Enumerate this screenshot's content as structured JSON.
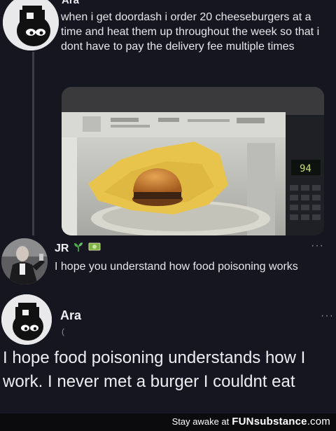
{
  "tweet1": {
    "author_name": "Ara",
    "text": "when i get doordash i order 20 cheeseburgers at a time and heat them up throughout the week so that i dont have to pay the delivery fee multiple times",
    "media": {
      "microwave_display": "94"
    }
  },
  "reply": {
    "author_name": "JR",
    "badges": [
      "seedling-icon",
      "money-icon"
    ],
    "more": "···",
    "text": "I hope you understand how food poisoning works"
  },
  "reply2": {
    "author_name": "Ara",
    "sub": "(",
    "more": "···",
    "text": "I hope food poisoning understands how I work. I never met a burger I couldnt eat"
  },
  "watermark": {
    "tagline": "Stay awake at",
    "brand_bold": "FUN",
    "brand_rest": "substance",
    "domain": ".com"
  },
  "colors": {
    "background": "#15161f",
    "text": "#e6e7ec",
    "muted": "#8a8d99"
  }
}
